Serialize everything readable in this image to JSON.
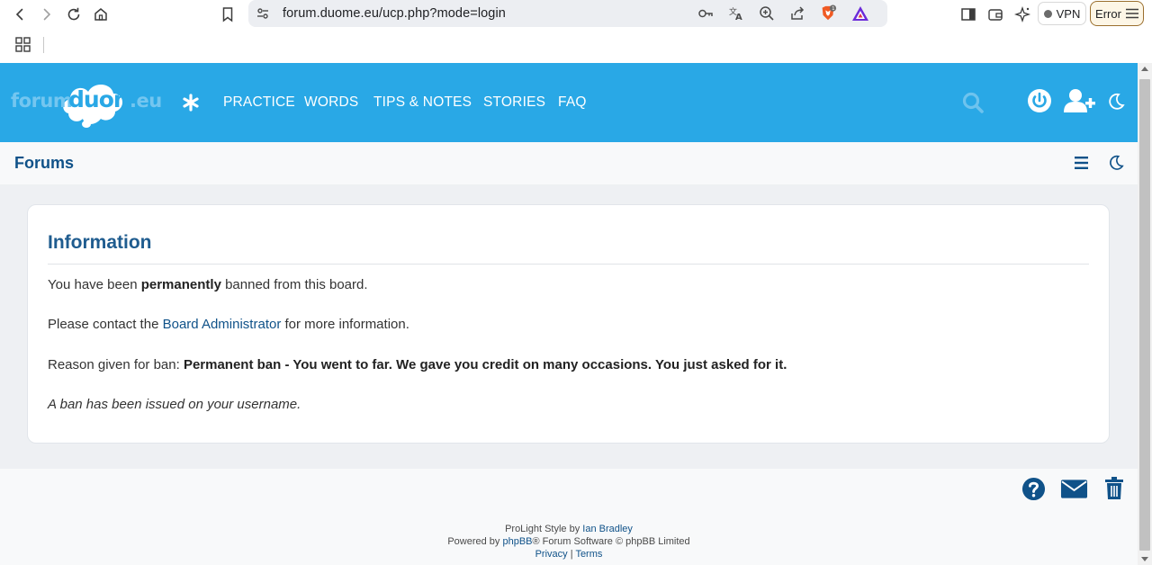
{
  "browser": {
    "url": "forum.duome.eu/ucp.php?mode=login",
    "vpn_label": "VPN",
    "error_label": "Error",
    "shield_badge": "1"
  },
  "site": {
    "logo_part1": "forum",
    "logo_part2": "duome",
    "logo_part3": ".eu",
    "nav": [
      "PRACTICE",
      "WORDS",
      "TIPS & NOTES",
      "STORIES",
      "FAQ"
    ],
    "accent_color": "#29a8e6"
  },
  "forum_bar": {
    "title": "Forums"
  },
  "info": {
    "title": "Information",
    "line1_pre": "You have been ",
    "line1_bold": "permanently",
    "line1_post": " banned from this board.",
    "line2_pre": "Please contact the ",
    "line2_link": "Board Administrator",
    "line2_post": " for more information.",
    "line3_pre": "Reason given for ban: ",
    "line3_bold": "Permanent ban - You went to far. We gave you credit on many occasions. You just asked for it.",
    "line4": "A ban has been issued on your username."
  },
  "footer": {
    "style_pre": "ProLight Style by ",
    "style_link": "Ian Bradley",
    "powered_pre": "Powered by ",
    "powered_link": "phpBB",
    "powered_post": "® Forum Software © phpBB Limited",
    "privacy": "Privacy",
    "separator": " | ",
    "terms": "Terms"
  }
}
